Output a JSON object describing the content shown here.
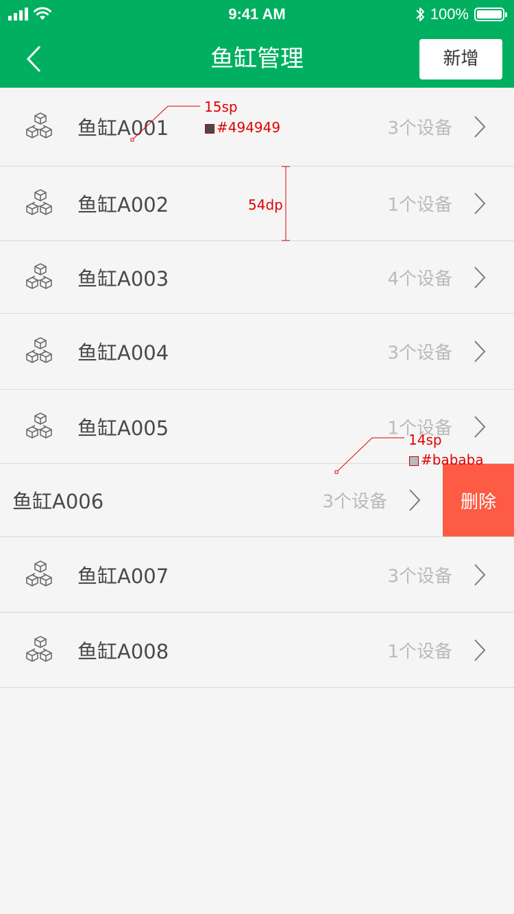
{
  "status_bar": {
    "time": "9:41 AM",
    "battery_text": "100%",
    "battery_level": 1.0
  },
  "nav": {
    "title": "鱼缸管理",
    "add_label": "新增",
    "bg_color": "#00b060"
  },
  "rows": [
    {
      "name": "鱼缸A001",
      "count": "3个设备"
    },
    {
      "name": "鱼缸A002",
      "count": "1个设备"
    },
    {
      "name": "鱼缸A003",
      "count": "4个设备"
    },
    {
      "name": "鱼缸A004",
      "count": "3个设备"
    },
    {
      "name": "鱼缸A005",
      "count": "1个设备"
    },
    {
      "name": "鱼缸A006",
      "count": "3个设备",
      "delete_label": "删除"
    },
    {
      "name": "鱼缸A007",
      "count": "3个设备"
    },
    {
      "name": "鱼缸A008",
      "count": "1个设备"
    }
  ],
  "annotations": {
    "title_size": "15sp",
    "title_color": "#494949",
    "row_height": "54dp",
    "count_size": "14sp",
    "count_color": "#bababa"
  },
  "colors": {
    "name_text": "#494949",
    "count_text": "#bababa",
    "delete_bg": "#fe5b44",
    "background": "#f5f5f5",
    "divider": "#d9d9d9"
  }
}
